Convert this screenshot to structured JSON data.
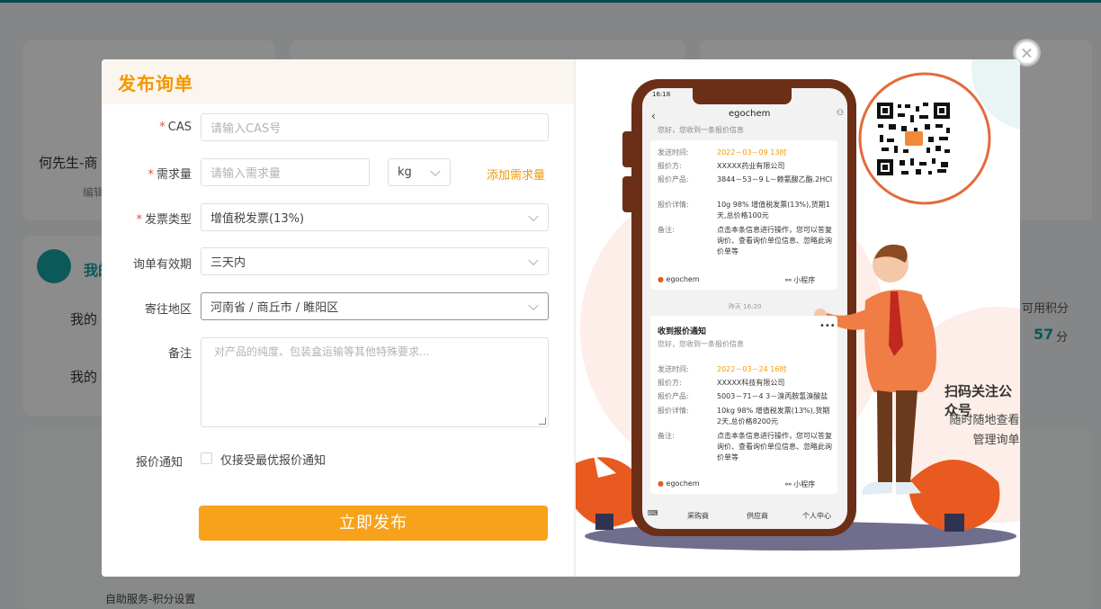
{
  "background": {
    "username": "何先生-商",
    "edit_label": "编辑",
    "section_title": "我的",
    "menu_item_1": "我的",
    "menu_item_2": "我的",
    "points_label": "可用积分",
    "points_value": "57",
    "points_unit": "分",
    "footer_link": "自助服务-积分设置"
  },
  "modal": {
    "title": "发布询单",
    "close_icon": "close-icon",
    "form": {
      "cas": {
        "label": "CAS",
        "placeholder": "请输入CAS号"
      },
      "quantity": {
        "label": "需求量",
        "placeholder": "请输入需求量",
        "unit": "kg",
        "add_link": "添加需求量"
      },
      "invoice": {
        "label": "发票类型",
        "value": "增值税发票(13%)"
      },
      "validity": {
        "label": "询单有效期",
        "value": "三天内"
      },
      "region": {
        "label": "寄往地区",
        "value": "河南省 / 商丘市 / 睢阳区"
      },
      "remark": {
        "label": "备注",
        "placeholder": "对产品的纯度、包装盒运输等其他特殊要求..."
      },
      "notice": {
        "label": "报价通知",
        "checkbox_label": "仅接受最优报价通知",
        "checked": false
      },
      "submit_label": "立即发布"
    },
    "promo": {
      "heading": "扫码关注公众号",
      "desc_line1": "随时随地查看报价",
      "desc_line2": "管理询单",
      "phone": {
        "status_time": "16:18",
        "app_title": "egochem",
        "top_msg_sub": "您好，您收到一条报价信息",
        "msg1": {
          "send_time_k": "发送时间:",
          "send_time_v": "2022－03－09 13时",
          "quoter_k": "报价方:",
          "quoter_v": "XXXXX药业有限公司",
          "product_k": "报价产品:",
          "product_v": "3844－53－9  L－赖氨酸乙酯.2HCl",
          "detail_k": "报价详情:",
          "detail_v": "10g 98% 增值税发票(13%),货期1天,总价格100元",
          "remark_k": "备注:",
          "remark_v": "点击本条信息进行操作，您可以答复询价、查看询价单位信息、忽略此询价单等",
          "brand": "egochem",
          "mini": "小程序"
        },
        "timestamp": "昨天 16:20",
        "msg2": {
          "title": "收到报价通知",
          "sub": "您好，您收到一条报价信息",
          "send_time_k": "发送时间:",
          "send_time_v": "2022－03－24 16时",
          "quoter_k": "报价方:",
          "quoter_v": "XXXXX科技有限公司",
          "product_k": "报价产品:",
          "product_v": "5003－71－4  3－溴丙胺氢溴酸盐",
          "detail_k": "报价详情:",
          "detail_v": "10kg 98% 增值税发票(13%),货期2天,总价格8200元",
          "remark_k": "备注:",
          "remark_v": "点击本条信息进行操作，您可以答复询价、查看询价单位信息、忽略此询价单等",
          "brand": "egochem",
          "mini": "小程序"
        },
        "nav": [
          "采购商",
          "供应商",
          "个人中心"
        ]
      }
    }
  },
  "colors": {
    "accent": "#f39800",
    "button": "#f7a21a",
    "phone_frame": "#6b2f17",
    "illustration_orange": "#e85a1f"
  }
}
